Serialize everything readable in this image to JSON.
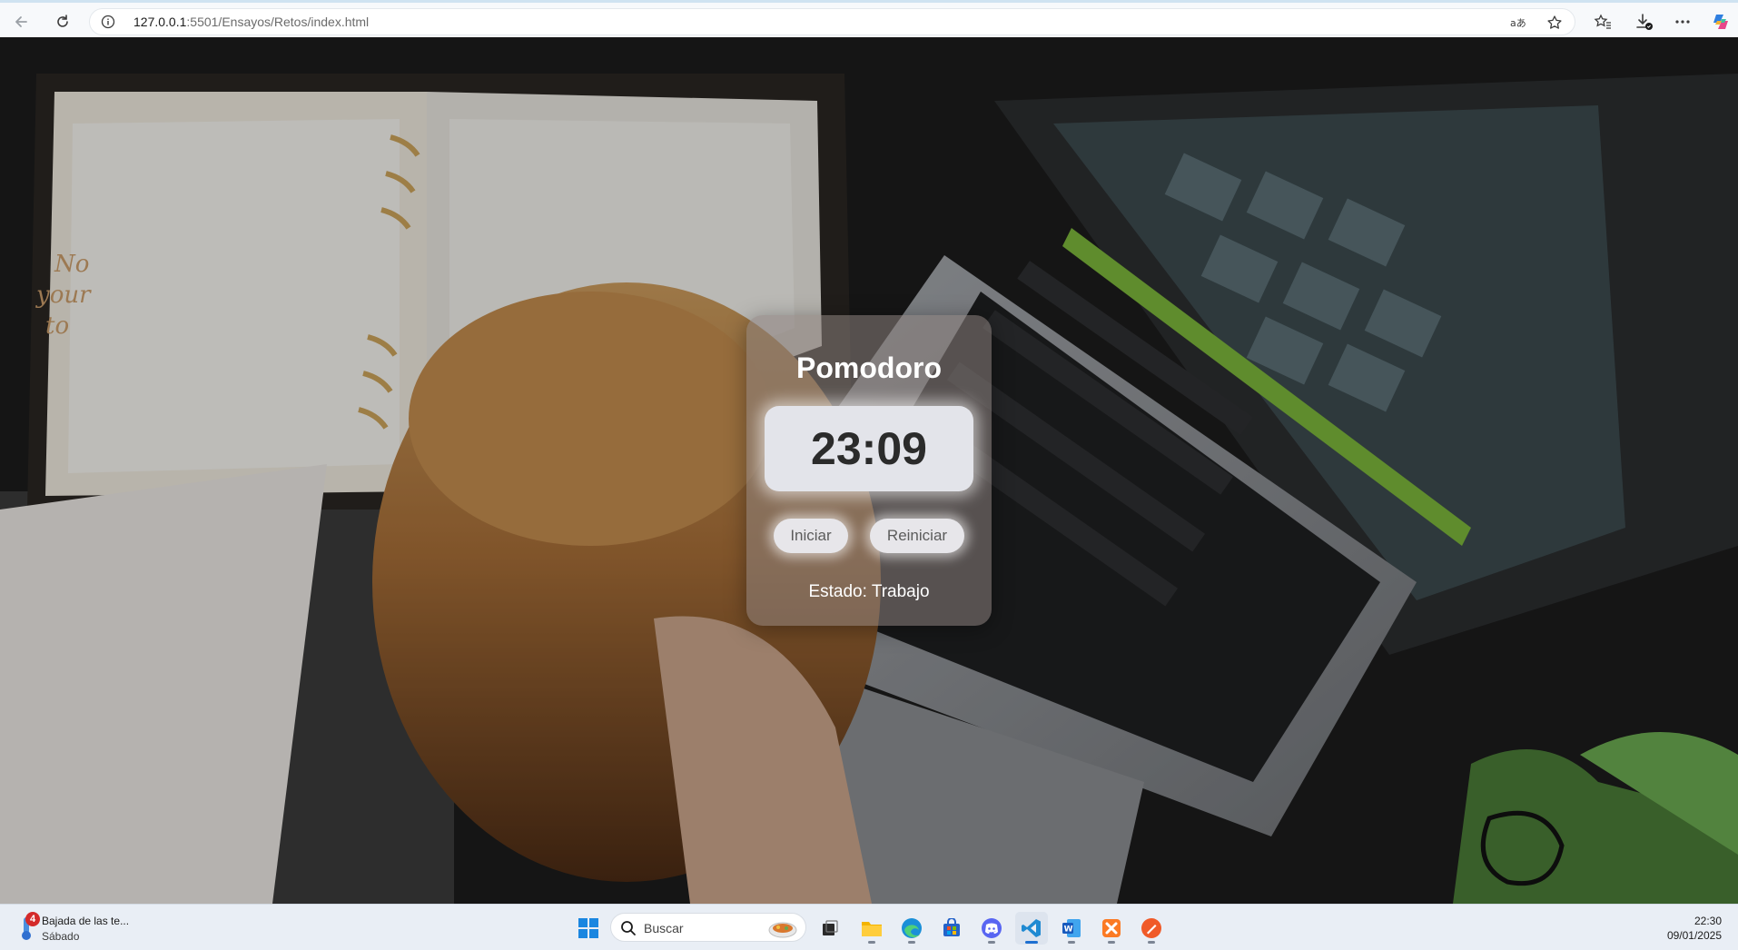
{
  "browser": {
    "url_host": "127.0.0.1",
    "url_path": ":5501/Ensayos/Retos/index.html",
    "icons": [
      "back-icon",
      "refresh-icon",
      "info-icon",
      "read-aloud-icon",
      "favorite-star-icon",
      "favorites-icon",
      "downloads-icon",
      "more-icon",
      "copilot-icon"
    ]
  },
  "app": {
    "title": "Pomodoro",
    "timer": "23:09",
    "start_label": "Iniciar",
    "reset_label": "Reiniciar",
    "status": "Estado: Trabajo"
  },
  "taskbar": {
    "weather_badge": "4",
    "weather_title": "Bajada de las te...",
    "weather_day": "Sábado",
    "search_placeholder": "Buscar",
    "apps": [
      "windows-start-icon",
      "task-view-icon",
      "file-explorer-icon",
      "edge-icon",
      "store-icon",
      "discord-icon",
      "vscode-icon",
      "word-icon",
      "xampp-icon",
      "brush-app-icon"
    ],
    "time": "22:30",
    "date": "09/01/2025"
  }
}
